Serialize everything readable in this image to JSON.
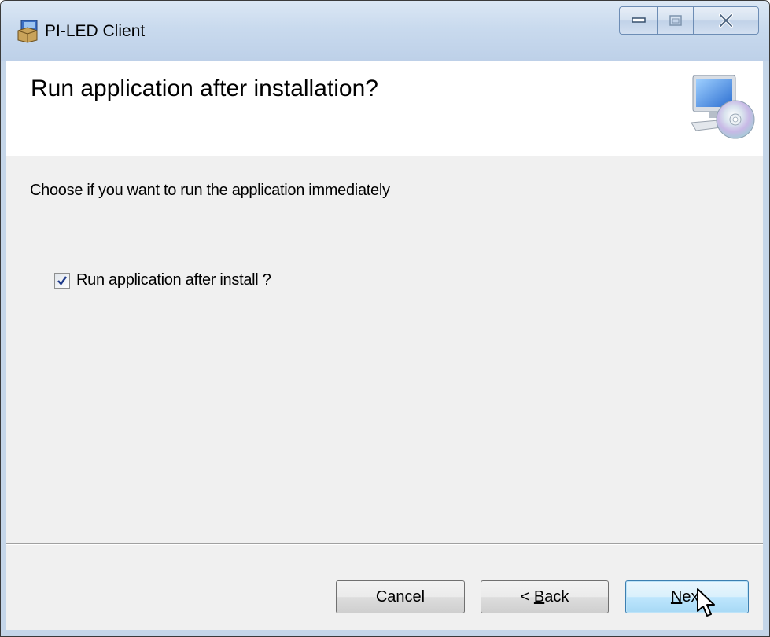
{
  "window": {
    "title": "PI-LED Client",
    "controls": [
      "minimize",
      "maximize",
      "close"
    ]
  },
  "banner": {
    "title": "Run application after installation?",
    "icon": "computer-cd-icon"
  },
  "body": {
    "instruction": "Choose if you want to run the application immediately",
    "checkbox": {
      "label": "Run application after install ?",
      "checked": true
    }
  },
  "buttons": {
    "cancel": "Cancel",
    "back_prefix": "< ",
    "back_accel": "B",
    "back_rest": "ack",
    "next_accel": "N",
    "next_rest": "ext"
  },
  "colors": {
    "titlebar": "#c9daee",
    "client_bg": "#f0f0f0",
    "banner_bg": "#ffffff",
    "default_button": "#3c7fb1"
  }
}
